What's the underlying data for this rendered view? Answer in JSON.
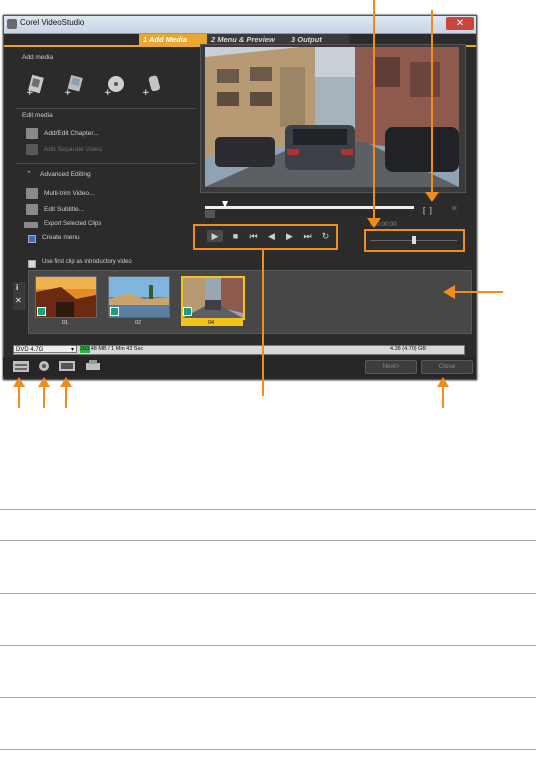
{
  "window": {
    "title": "Corel VideoStudio",
    "close_glyph": "✕"
  },
  "tabs": [
    {
      "num": "1",
      "label": "Add Media"
    },
    {
      "num": "2",
      "label": "Menu & Preview"
    },
    {
      "num": "3",
      "label": "Output"
    }
  ],
  "left": {
    "add_media_label": "Add media",
    "edit_media_label": "Edit media",
    "add_edit_chapter": "Add/Edit Chapter...",
    "add_separate_video": "Add Separate Video",
    "advanced_editing": "Advanced Editing",
    "multi_trim": "Multi-trim Video...",
    "edit_subtitle": "Edit Subtitle...",
    "export_selected": "Export Selected Clips",
    "create_menu": "Create menu",
    "use_first_clip": "Use first clip as introductory video"
  },
  "preview": {
    "timecode": "000:00:00"
  },
  "clips": [
    {
      "num": "01"
    },
    {
      "num": "02"
    },
    {
      "num": "04"
    }
  ],
  "disc": {
    "type": "DVD 4.7G",
    "used": "203.48 MB / 1 Min 43 Sec",
    "capacity": "4.38 (4.70) GB"
  },
  "buttons": {
    "next": "Next>",
    "close": "Close"
  },
  "icons": {
    "title_icon": "app-icon",
    "media_buttons": [
      "add-video-icon",
      "add-image-icon",
      "add-disc-icon",
      "add-device-icon"
    ],
    "bottom_icons": [
      "project-settings-icon",
      "preferences-icon",
      "quality-icon",
      "burn-icon"
    ]
  },
  "colors": {
    "annotation_orange": "#f28c1a",
    "active_tab": "#e9a82d",
    "selected_clip": "#f2c318"
  }
}
